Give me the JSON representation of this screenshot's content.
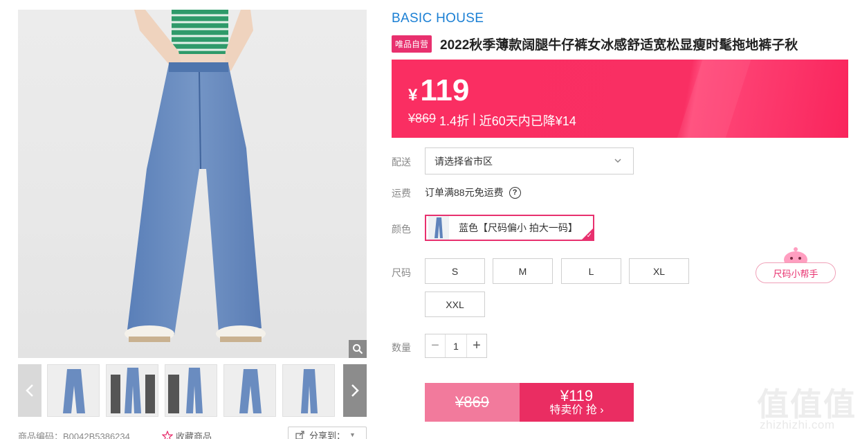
{
  "gallery": {
    "product_code": "商品编码：B0042B5386234",
    "favorite_label": "收藏商品",
    "share_label": "分享到："
  },
  "product": {
    "brand": "BASIC HOUSE",
    "self_badge": "唯品自营",
    "title": "2022秋季薄款阔腿牛仔裤女冰感舒适宽松显瘦时髦拖地裤子秋"
  },
  "price": {
    "currency": "¥",
    "current": "119",
    "original": "¥869",
    "discount": "1.4折",
    "separator": "|",
    "drop_note": "近60天内已降¥14"
  },
  "shipping": {
    "label": "配送",
    "placeholder": "请选择省市区"
  },
  "fee": {
    "label": "运费",
    "text": "订单满88元免运费",
    "help": "?"
  },
  "color": {
    "label": "颜色",
    "selected": "蓝色【尺码偏小 拍大一码】"
  },
  "size": {
    "label": "尺码",
    "options": [
      "S",
      "M",
      "L",
      "XL",
      "XXL"
    ],
    "helper_label": "尺码小帮手"
  },
  "quantity": {
    "label": "数量",
    "minus": "−",
    "value": "1",
    "plus": "+"
  },
  "buy": {
    "original_price": "¥869",
    "sale_price": "¥119",
    "cta": "特卖价 抢 ›"
  },
  "watermark": {
    "glyph": "值值值",
    "url": "zhizhizhi.com"
  },
  "colors": {
    "accent": "#e8306e",
    "brand_blue": "#1a7fd4",
    "banner": "#fa2e62"
  }
}
